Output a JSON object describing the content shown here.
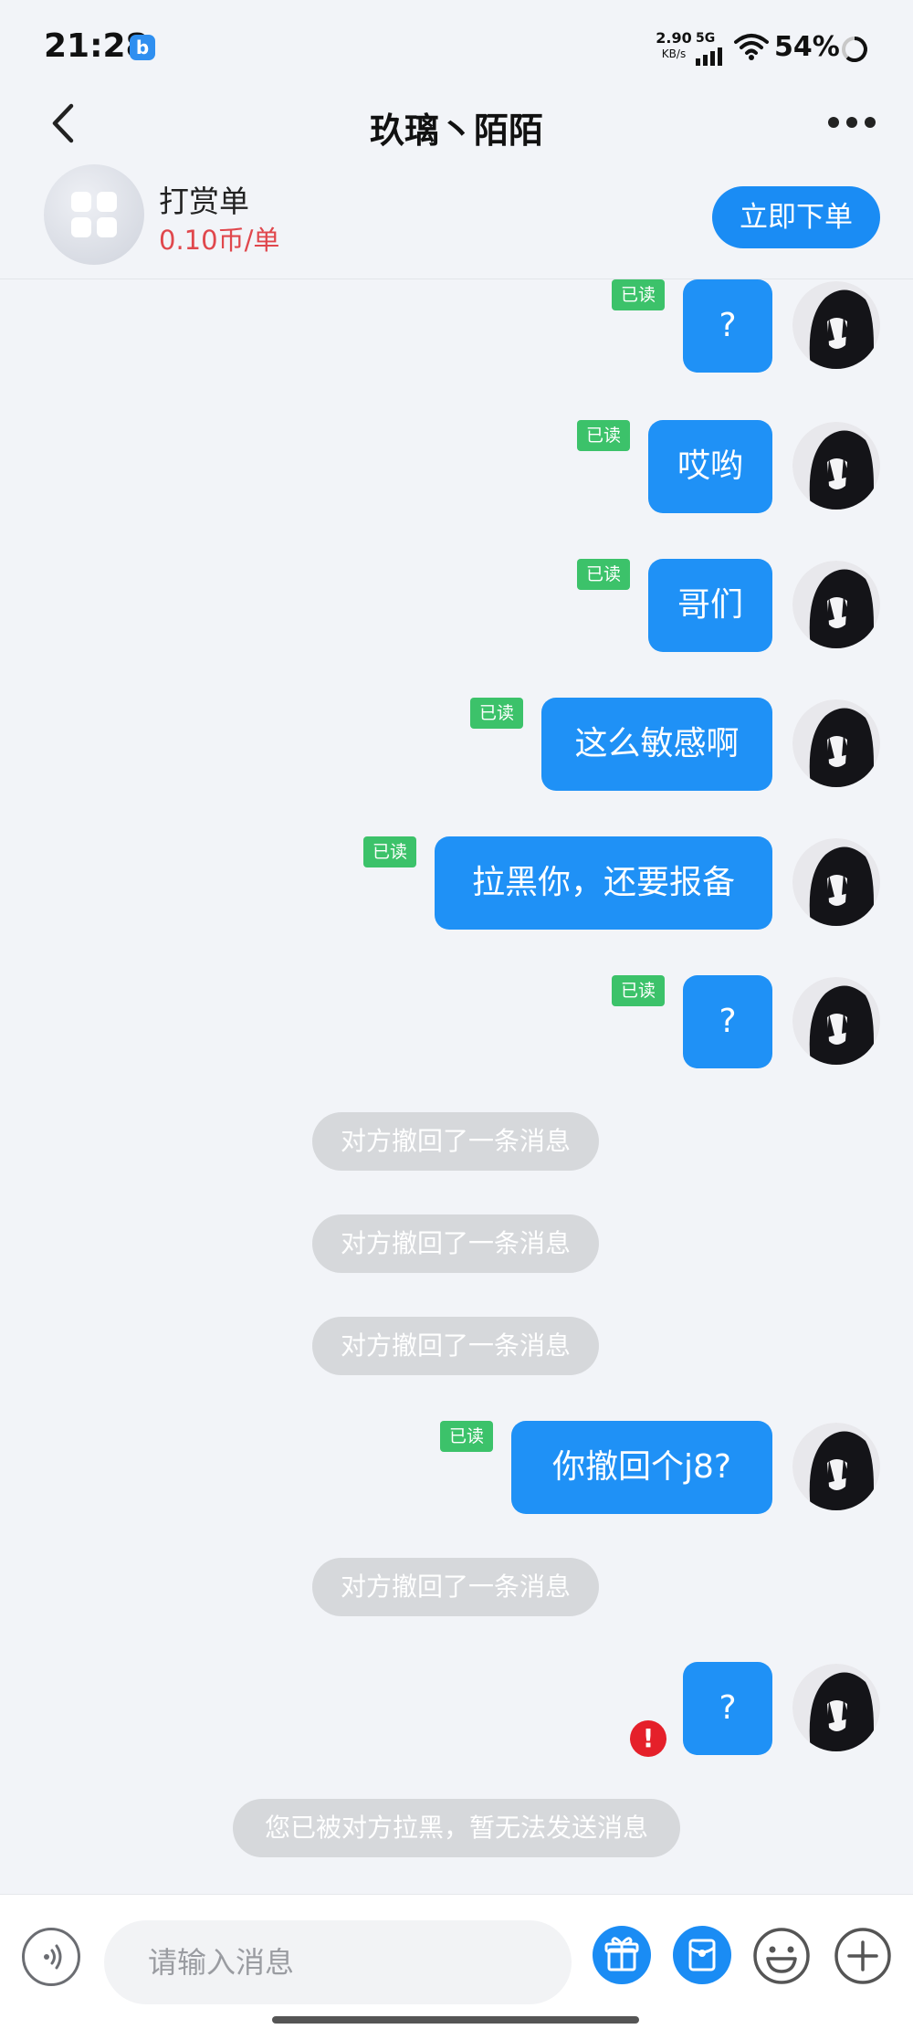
{
  "status_bar": {
    "time": "21:28",
    "app_icon": "b",
    "net_speed_value": "2.90",
    "net_speed_unit": "KB/s",
    "network_type": "5G",
    "battery": "54%",
    "icons": [
      "wifi-icon",
      "signal-icon",
      "battery-ring-icon"
    ]
  },
  "header": {
    "title": "玖璃丶陌陌",
    "back_icon": "chevron-left-icon",
    "more_icon": "more-dots-icon"
  },
  "order": {
    "title": "打赏单",
    "price": "0.10币/单",
    "button_label": "立即下单",
    "icon": "grid-apps-icon"
  },
  "messages": {
    "read_label": "已读",
    "items": [
      {
        "type": "sent",
        "text": "?",
        "read": true
      },
      {
        "type": "sent",
        "text": "哎哟",
        "read": true
      },
      {
        "type": "sent",
        "text": "哥们",
        "read": true
      },
      {
        "type": "sent",
        "text": "这么敏感啊",
        "read": true
      },
      {
        "type": "sent",
        "text": "拉黑你，还要报备",
        "read": true
      },
      {
        "type": "sent",
        "text": "?",
        "read": true
      },
      {
        "type": "system",
        "text": "对方撤回了一条消息"
      },
      {
        "type": "system",
        "text": "对方撤回了一条消息"
      },
      {
        "type": "system",
        "text": "对方撤回了一条消息"
      },
      {
        "type": "sent",
        "text": "你撤回个j8?",
        "read": true
      },
      {
        "type": "system",
        "text": "对方撤回了一条消息"
      },
      {
        "type": "sent",
        "text": "?",
        "read": false,
        "failed": true
      },
      {
        "type": "system",
        "text": "您已被对方拉黑，暂无法发送消息"
      }
    ]
  },
  "input_bar": {
    "placeholder": "请输入消息",
    "icons": [
      "voice-icon",
      "gift-icon",
      "red-packet-icon",
      "emoji-icon",
      "plus-icon"
    ]
  },
  "colors": {
    "accent": "#1f91f6",
    "read_tag": "#3cc26a",
    "price": "#e0474c",
    "error": "#e5202a",
    "system_pill": "#d6d8db",
    "background": "#f2f4f8"
  }
}
